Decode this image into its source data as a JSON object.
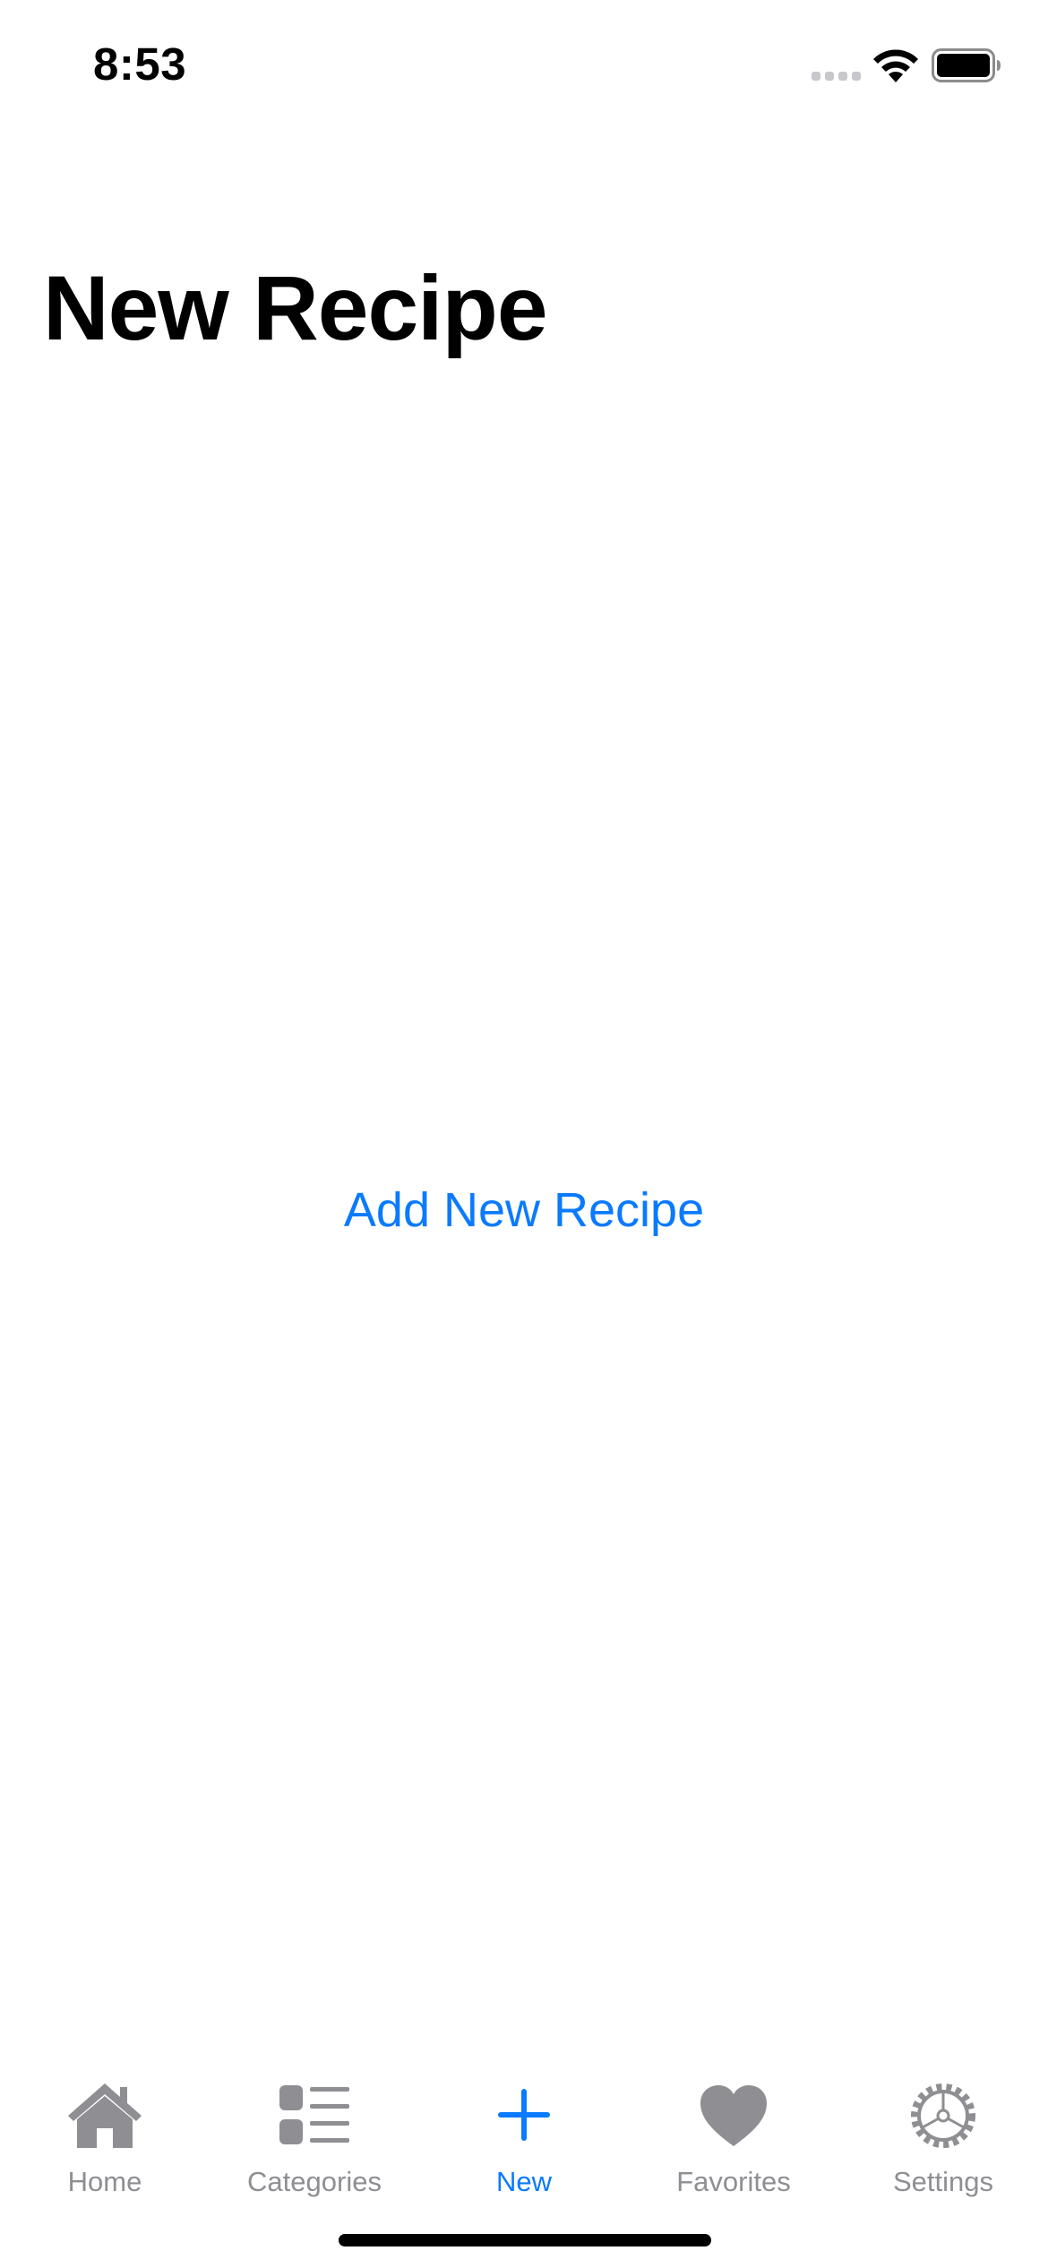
{
  "status_bar": {
    "time": "8:53"
  },
  "page": {
    "title": "New Recipe"
  },
  "main": {
    "add_recipe_label": "Add New Recipe"
  },
  "tab_bar": {
    "active_color": "#0a7aff",
    "inactive_color": "#8e8e93",
    "items": [
      {
        "label": "Home",
        "icon": "house-icon",
        "active": false
      },
      {
        "label": "Categories",
        "icon": "list-icon",
        "active": false
      },
      {
        "label": "New",
        "icon": "plus-icon",
        "active": true
      },
      {
        "label": "Favorites",
        "icon": "heart-icon",
        "active": false
      },
      {
        "label": "Settings",
        "icon": "gear-icon",
        "active": false
      }
    ]
  }
}
